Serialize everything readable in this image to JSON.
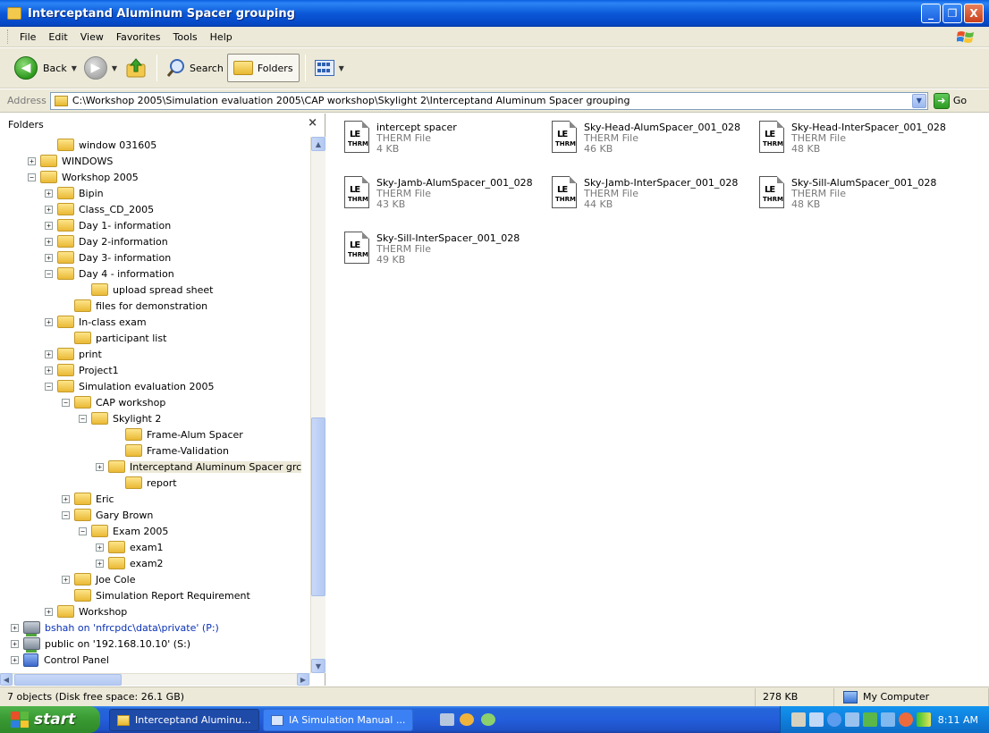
{
  "window": {
    "title": "Interceptand Aluminum Spacer grouping",
    "controls": {
      "minimize": "_",
      "maximize": "❐",
      "close": "X"
    }
  },
  "menu": [
    "File",
    "Edit",
    "View",
    "Favorites",
    "Tools",
    "Help"
  ],
  "toolbar": {
    "back_label": "Back",
    "search_label": "Search",
    "folders_label": "Folders"
  },
  "address": {
    "label": "Address",
    "value": "C:\\Workshop 2005\\Simulation evaluation 2005\\CAP workshop\\Skylight 2\\Interceptand Aluminum Spacer grouping",
    "go_label": "Go"
  },
  "folders_pane": {
    "header": "Folders",
    "close_glyph": "×",
    "tree": [
      {
        "label": "window 031605",
        "level": 3,
        "expander": "",
        "icon": "folder-icon"
      },
      {
        "label": "WINDOWS",
        "level": 2,
        "expander": "+",
        "icon": "folder-icon"
      },
      {
        "label": "Workshop 2005",
        "level": 2,
        "expander": "−",
        "icon": "folder-icon"
      },
      {
        "label": "Bipin",
        "level": 3,
        "expander": "+",
        "icon": "folder-icon"
      },
      {
        "label": "Class_CD_2005",
        "level": 3,
        "expander": "+",
        "icon": "folder-icon"
      },
      {
        "label": "Day 1- information",
        "level": 3,
        "expander": "+",
        "icon": "folder-icon"
      },
      {
        "label": "Day 2-information",
        "level": 3,
        "expander": "+",
        "icon": "folder-icon"
      },
      {
        "label": "Day 3- information",
        "level": 3,
        "expander": "+",
        "icon": "folder-icon"
      },
      {
        "label": "Day 4 - information",
        "level": 3,
        "expander": "−",
        "icon": "folder-icon"
      },
      {
        "label": "upload spread sheet",
        "level": 5,
        "expander": "",
        "icon": "folder-icon"
      },
      {
        "label": "files for demonstration",
        "level": 4,
        "expander": "",
        "icon": "folder-icon"
      },
      {
        "label": "In-class exam",
        "level": 3,
        "expander": "+",
        "icon": "folder-icon"
      },
      {
        "label": "participant list",
        "level": 4,
        "expander": "",
        "icon": "folder-icon"
      },
      {
        "label": "print",
        "level": 3,
        "expander": "+",
        "icon": "folder-icon"
      },
      {
        "label": "Project1",
        "level": 3,
        "expander": "+",
        "icon": "folder-icon"
      },
      {
        "label": "Simulation evaluation 2005",
        "level": 3,
        "expander": "−",
        "icon": "folder-icon"
      },
      {
        "label": "CAP workshop",
        "level": 4,
        "expander": "−",
        "icon": "folder-icon"
      },
      {
        "label": "Skylight 2",
        "level": 5,
        "expander": "−",
        "icon": "folder-icon"
      },
      {
        "label": "Frame-Alum Spacer",
        "level": 7,
        "expander": "",
        "icon": "folder-icon"
      },
      {
        "label": "Frame-Validation",
        "level": 7,
        "expander": "",
        "icon": "folder-icon"
      },
      {
        "label": "Interceptand Aluminum Spacer grc",
        "level": 6,
        "expander": "+",
        "icon": "folder-icon",
        "selected": true
      },
      {
        "label": "report",
        "level": 7,
        "expander": "",
        "icon": "folder-icon"
      },
      {
        "label": "Eric",
        "level": 4,
        "expander": "+",
        "icon": "folder-icon"
      },
      {
        "label": "Gary Brown",
        "level": 4,
        "expander": "−",
        "icon": "folder-icon"
      },
      {
        "label": "Exam 2005",
        "level": 5,
        "expander": "−",
        "icon": "folder-icon"
      },
      {
        "label": "exam1",
        "level": 6,
        "expander": "+",
        "icon": "folder-icon"
      },
      {
        "label": "exam2",
        "level": 6,
        "expander": "+",
        "icon": "folder-icon"
      },
      {
        "label": "Joe Cole",
        "level": 4,
        "expander": "+",
        "icon": "folder-icon"
      },
      {
        "label": "Simulation Report Requirement",
        "level": 4,
        "expander": "",
        "icon": "folder-icon"
      },
      {
        "label": "Workshop",
        "level": 3,
        "expander": "+",
        "icon": "folder-icon"
      },
      {
        "label": "bshah on 'nfrcpdc\\data\\private' (P:)",
        "level": 1,
        "expander": "+",
        "icon": "network-drive-icon",
        "link": true
      },
      {
        "label": "public on '192.168.10.10' (S:)",
        "level": 1,
        "expander": "+",
        "icon": "network-drive-icon"
      },
      {
        "label": "Control Panel",
        "level": 1,
        "expander": "+",
        "icon": "control-panel-icon"
      }
    ]
  },
  "files": [
    {
      "name": "intercept spacer",
      "type": "THERM File",
      "size": "4 KB"
    },
    {
      "name": "Sky-Head-AlumSpacer_001_028",
      "type": "THERM File",
      "size": "46 KB"
    },
    {
      "name": "Sky-Head-InterSpacer_001_028",
      "type": "THERM File",
      "size": "48 KB"
    },
    {
      "name": "Sky-Jamb-AlumSpacer_001_028",
      "type": "THERM File",
      "size": "43 KB"
    },
    {
      "name": "Sky-Jamb-InterSpacer_001_028",
      "type": "THERM File",
      "size": "44 KB"
    },
    {
      "name": "Sky-Sill-AlumSpacer_001_028",
      "type": "THERM File",
      "size": "48 KB"
    },
    {
      "name": "Sky-Sill-InterSpacer_001_028",
      "type": "THERM File",
      "size": "49 KB"
    }
  ],
  "therm_icon": {
    "top": "LE",
    "bottom": "THRM"
  },
  "status": {
    "objects": "7 objects (Disk free space: 26.1 GB)",
    "size": "278 KB",
    "location": "My Computer"
  },
  "taskbar": {
    "start_label": "start",
    "tasks": [
      {
        "label": "Interceptand Aluminu...",
        "active": true
      },
      {
        "label": "IA Simulation Manual ...",
        "active": false
      }
    ],
    "clock": "8:11 AM"
  },
  "colors": {
    "titlebar": "#0b58d8",
    "chrome": "#ece9d8",
    "taskbar": "#245edb",
    "start": "#3a9a33",
    "tray": "#0f80dc"
  }
}
